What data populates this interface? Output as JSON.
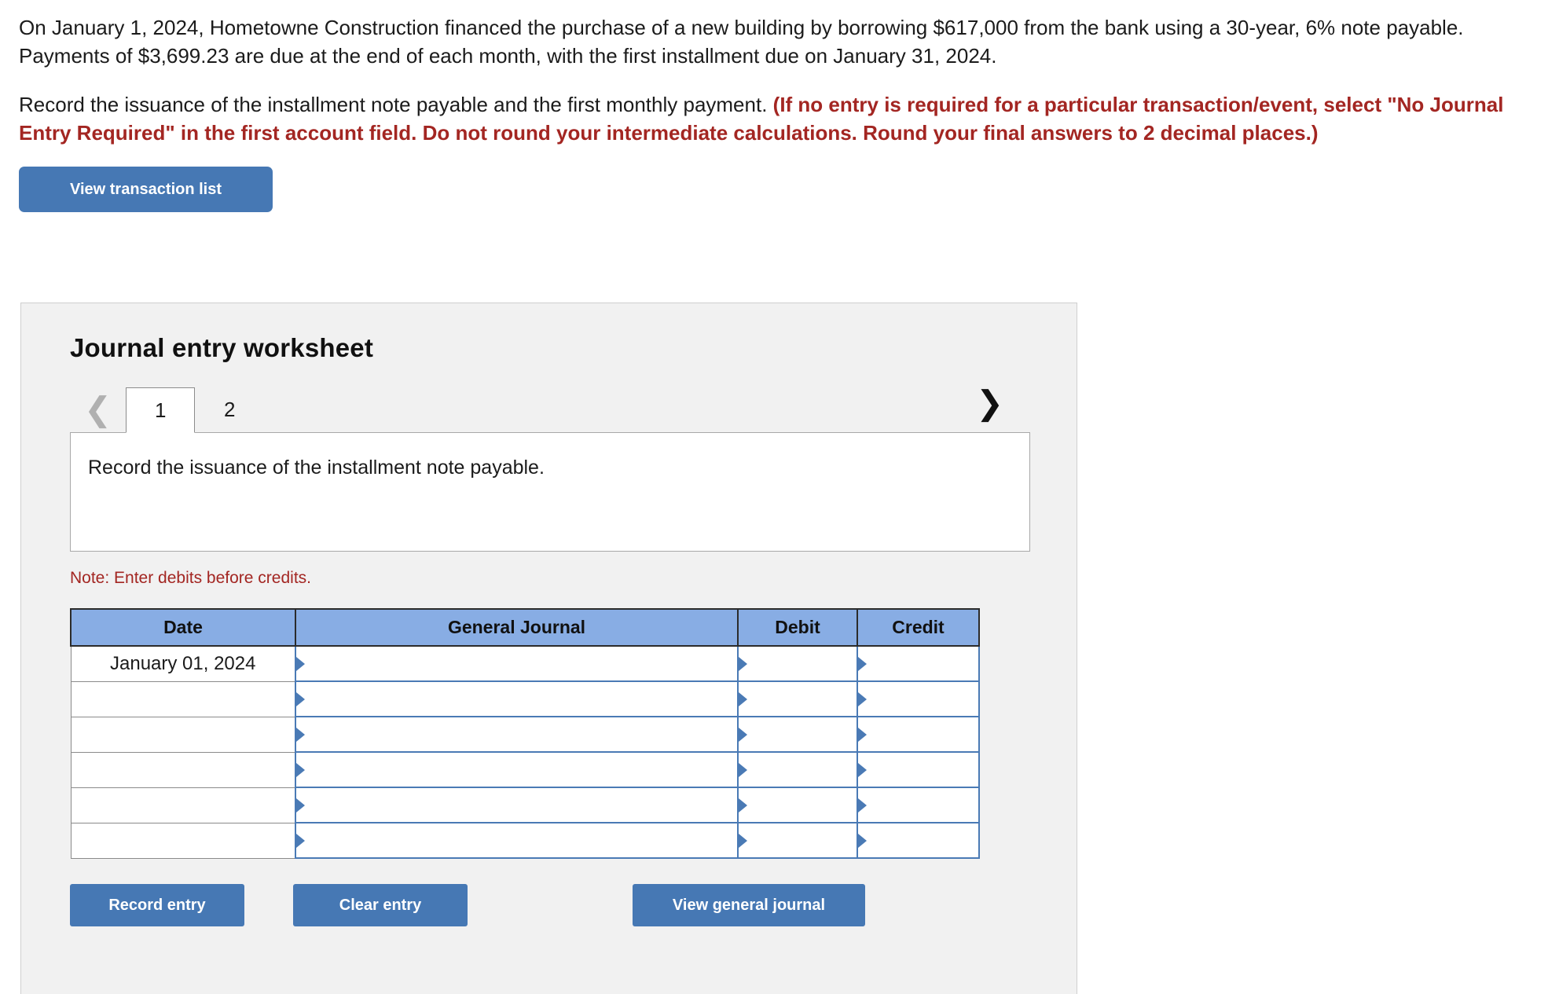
{
  "problem": {
    "paragraph1": "On January 1, 2024, Hometowne Construction financed the purchase of a new building by borrowing $617,000 from the bank using a 30-year, 6% note payable. Payments of $3,699.23 are due at the end of each month, with the first installment due on January 31, 2024.",
    "paragraph2_plain": "Record the issuance of the installment note payable and the first monthly payment. ",
    "paragraph2_emphasis": "(If no entry is required for a particular transaction/event, select \"No Journal Entry Required\" in the first account field. Do not round your intermediate calculations. Round your final answers to 2 decimal places.)"
  },
  "toolbar": {
    "view_transaction_list_label": "View transaction list"
  },
  "worksheet": {
    "title": "Journal entry worksheet",
    "prev_icon": "chevron-left-icon",
    "next_icon": "chevron-right-icon",
    "tabs": [
      {
        "label": "1",
        "active": true
      },
      {
        "label": "2",
        "active": false
      }
    ],
    "description": "Record the issuance of the installment note payable.",
    "note": "Note: Enter debits before credits.",
    "table": {
      "headers": [
        "Date",
        "General Journal",
        "Debit",
        "Credit"
      ],
      "rows": [
        {
          "date": "January 01, 2024",
          "general_journal": "",
          "debit": "",
          "credit": ""
        },
        {
          "date": "",
          "general_journal": "",
          "debit": "",
          "credit": ""
        },
        {
          "date": "",
          "general_journal": "",
          "debit": "",
          "credit": ""
        },
        {
          "date": "",
          "general_journal": "",
          "debit": "",
          "credit": ""
        },
        {
          "date": "",
          "general_journal": "",
          "debit": "",
          "credit": ""
        },
        {
          "date": "",
          "general_journal": "",
          "debit": "",
          "credit": ""
        }
      ]
    },
    "buttons": {
      "record_entry": "Record entry",
      "clear_entry": "Clear entry",
      "view_general_journal": "View general journal"
    }
  },
  "colors": {
    "button_blue": "#4678b4",
    "header_blue": "#88ade4",
    "red_text": "#a32622",
    "panel_bg": "#f1f1f1",
    "input_border_blue": "#4a7ab5"
  }
}
